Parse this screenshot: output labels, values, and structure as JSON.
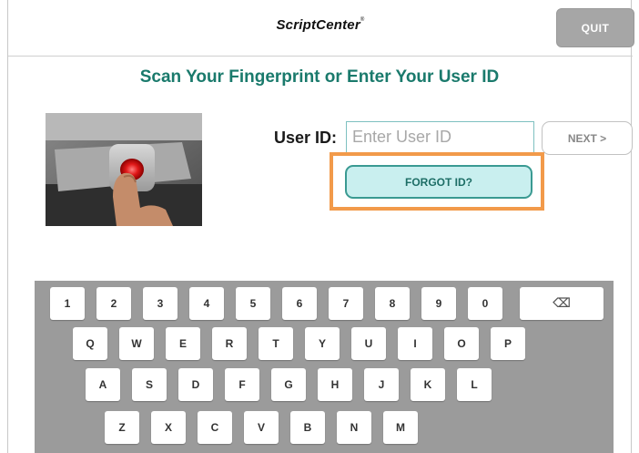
{
  "header": {
    "brand": "ScriptCenter",
    "brand_mark": "®",
    "quit_label": "QUIT"
  },
  "main": {
    "heading": "Scan Your Fingerprint or Enter Your User ID",
    "userid_label": "User ID:",
    "userid_value": "",
    "userid_placeholder": "Enter User ID",
    "next_label": "NEXT >",
    "forgot_label": "FORGOT ID?"
  },
  "keyboard": {
    "row1": [
      "1",
      "2",
      "3",
      "4",
      "5",
      "6",
      "7",
      "8",
      "9",
      "0"
    ],
    "backspace_glyph": "⌫",
    "row2": [
      "Q",
      "W",
      "E",
      "R",
      "T",
      "Y",
      "U",
      "I",
      "O",
      "P"
    ],
    "row3": [
      "A",
      "S",
      "D",
      "F",
      "G",
      "H",
      "J",
      "K",
      "L"
    ],
    "row4": [
      "Z",
      "X",
      "C",
      "V",
      "B",
      "N",
      "M"
    ]
  },
  "colors": {
    "accent_teal": "#1a7a6c",
    "highlight_orange": "#f29a4a",
    "forgot_bg": "#c9efef",
    "quit_bg": "#a6a6a6",
    "keyboard_bg": "#9b9b9b"
  },
  "icons": {
    "backspace": "backspace-icon",
    "fingerprint_photo": "fingerprint-scanner-photo"
  }
}
